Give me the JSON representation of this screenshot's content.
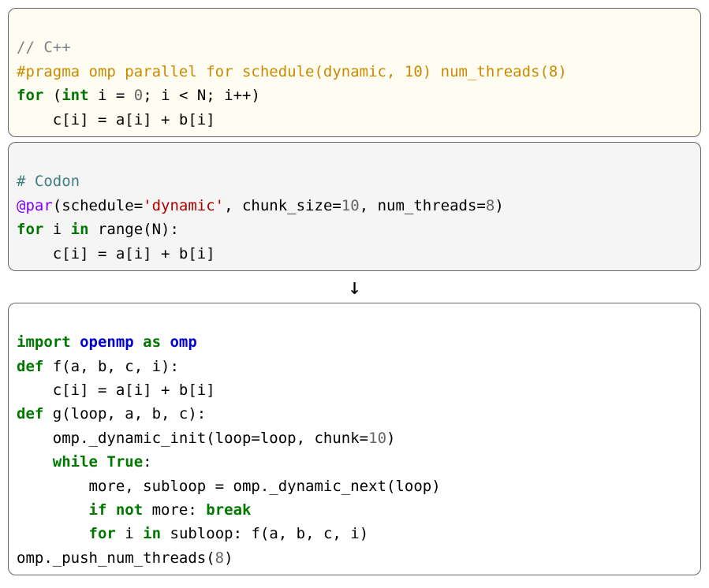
{
  "cpp": {
    "comment": "// C++",
    "pragma": "#pragma omp parallel for schedule(dynamic, 10) num_threads(8)",
    "for_kw": "for",
    "int_kw": "int",
    "loop_init": " i = ",
    "zero": "0",
    "loop_cond": "; i < N; i++)",
    "body": "    c[i] = a[i] + b[i]"
  },
  "codon": {
    "comment": "# Codon",
    "decorator": "@par",
    "dec_open": "(schedule=",
    "dec_str": "'dynamic'",
    "dec_rest1": ", chunk_size=",
    "ten": "10",
    "dec_rest2": ", num_threads=",
    "eight": "8",
    "dec_close": ")",
    "for_kw": "for",
    "loop_line": " i ",
    "in_kw": "in",
    "range_call": " range(N):",
    "body": "    c[i] = a[i] + b[i]"
  },
  "arrow": "↓",
  "result": {
    "import_kw": "import",
    "module": " openmp ",
    "as_kw": "as",
    "alias": " omp",
    "def_kw": "def",
    "f_sig": " f(a, b, c, i):",
    "f_body": "    c[i] = a[i] + b[i]",
    "g_sig": " g(loop, a, b, c):",
    "g_line1_a": "    omp._dynamic_init(loop=loop, chunk=",
    "g_line1_num": "10",
    "g_line1_b": ")",
    "g_line2_indent": "    ",
    "while_kw": "while",
    "true_kw": " True",
    "colon": ":",
    "g_line3": "        more, subloop = omp._dynamic_next(loop)",
    "g_line4_indent": "        ",
    "if_kw": "if",
    "not_kw": " not",
    "more_text": " more: ",
    "break_kw": "break",
    "g_line5_indent": "        ",
    "for_kw": "for",
    "g_line5_mid": " i ",
    "in_kw": "in",
    "g_line5_rest": " subloop: f(a, b, c, i)",
    "last_a": "omp._push_num_threads(",
    "last_num": "8",
    "last_b": ")"
  }
}
